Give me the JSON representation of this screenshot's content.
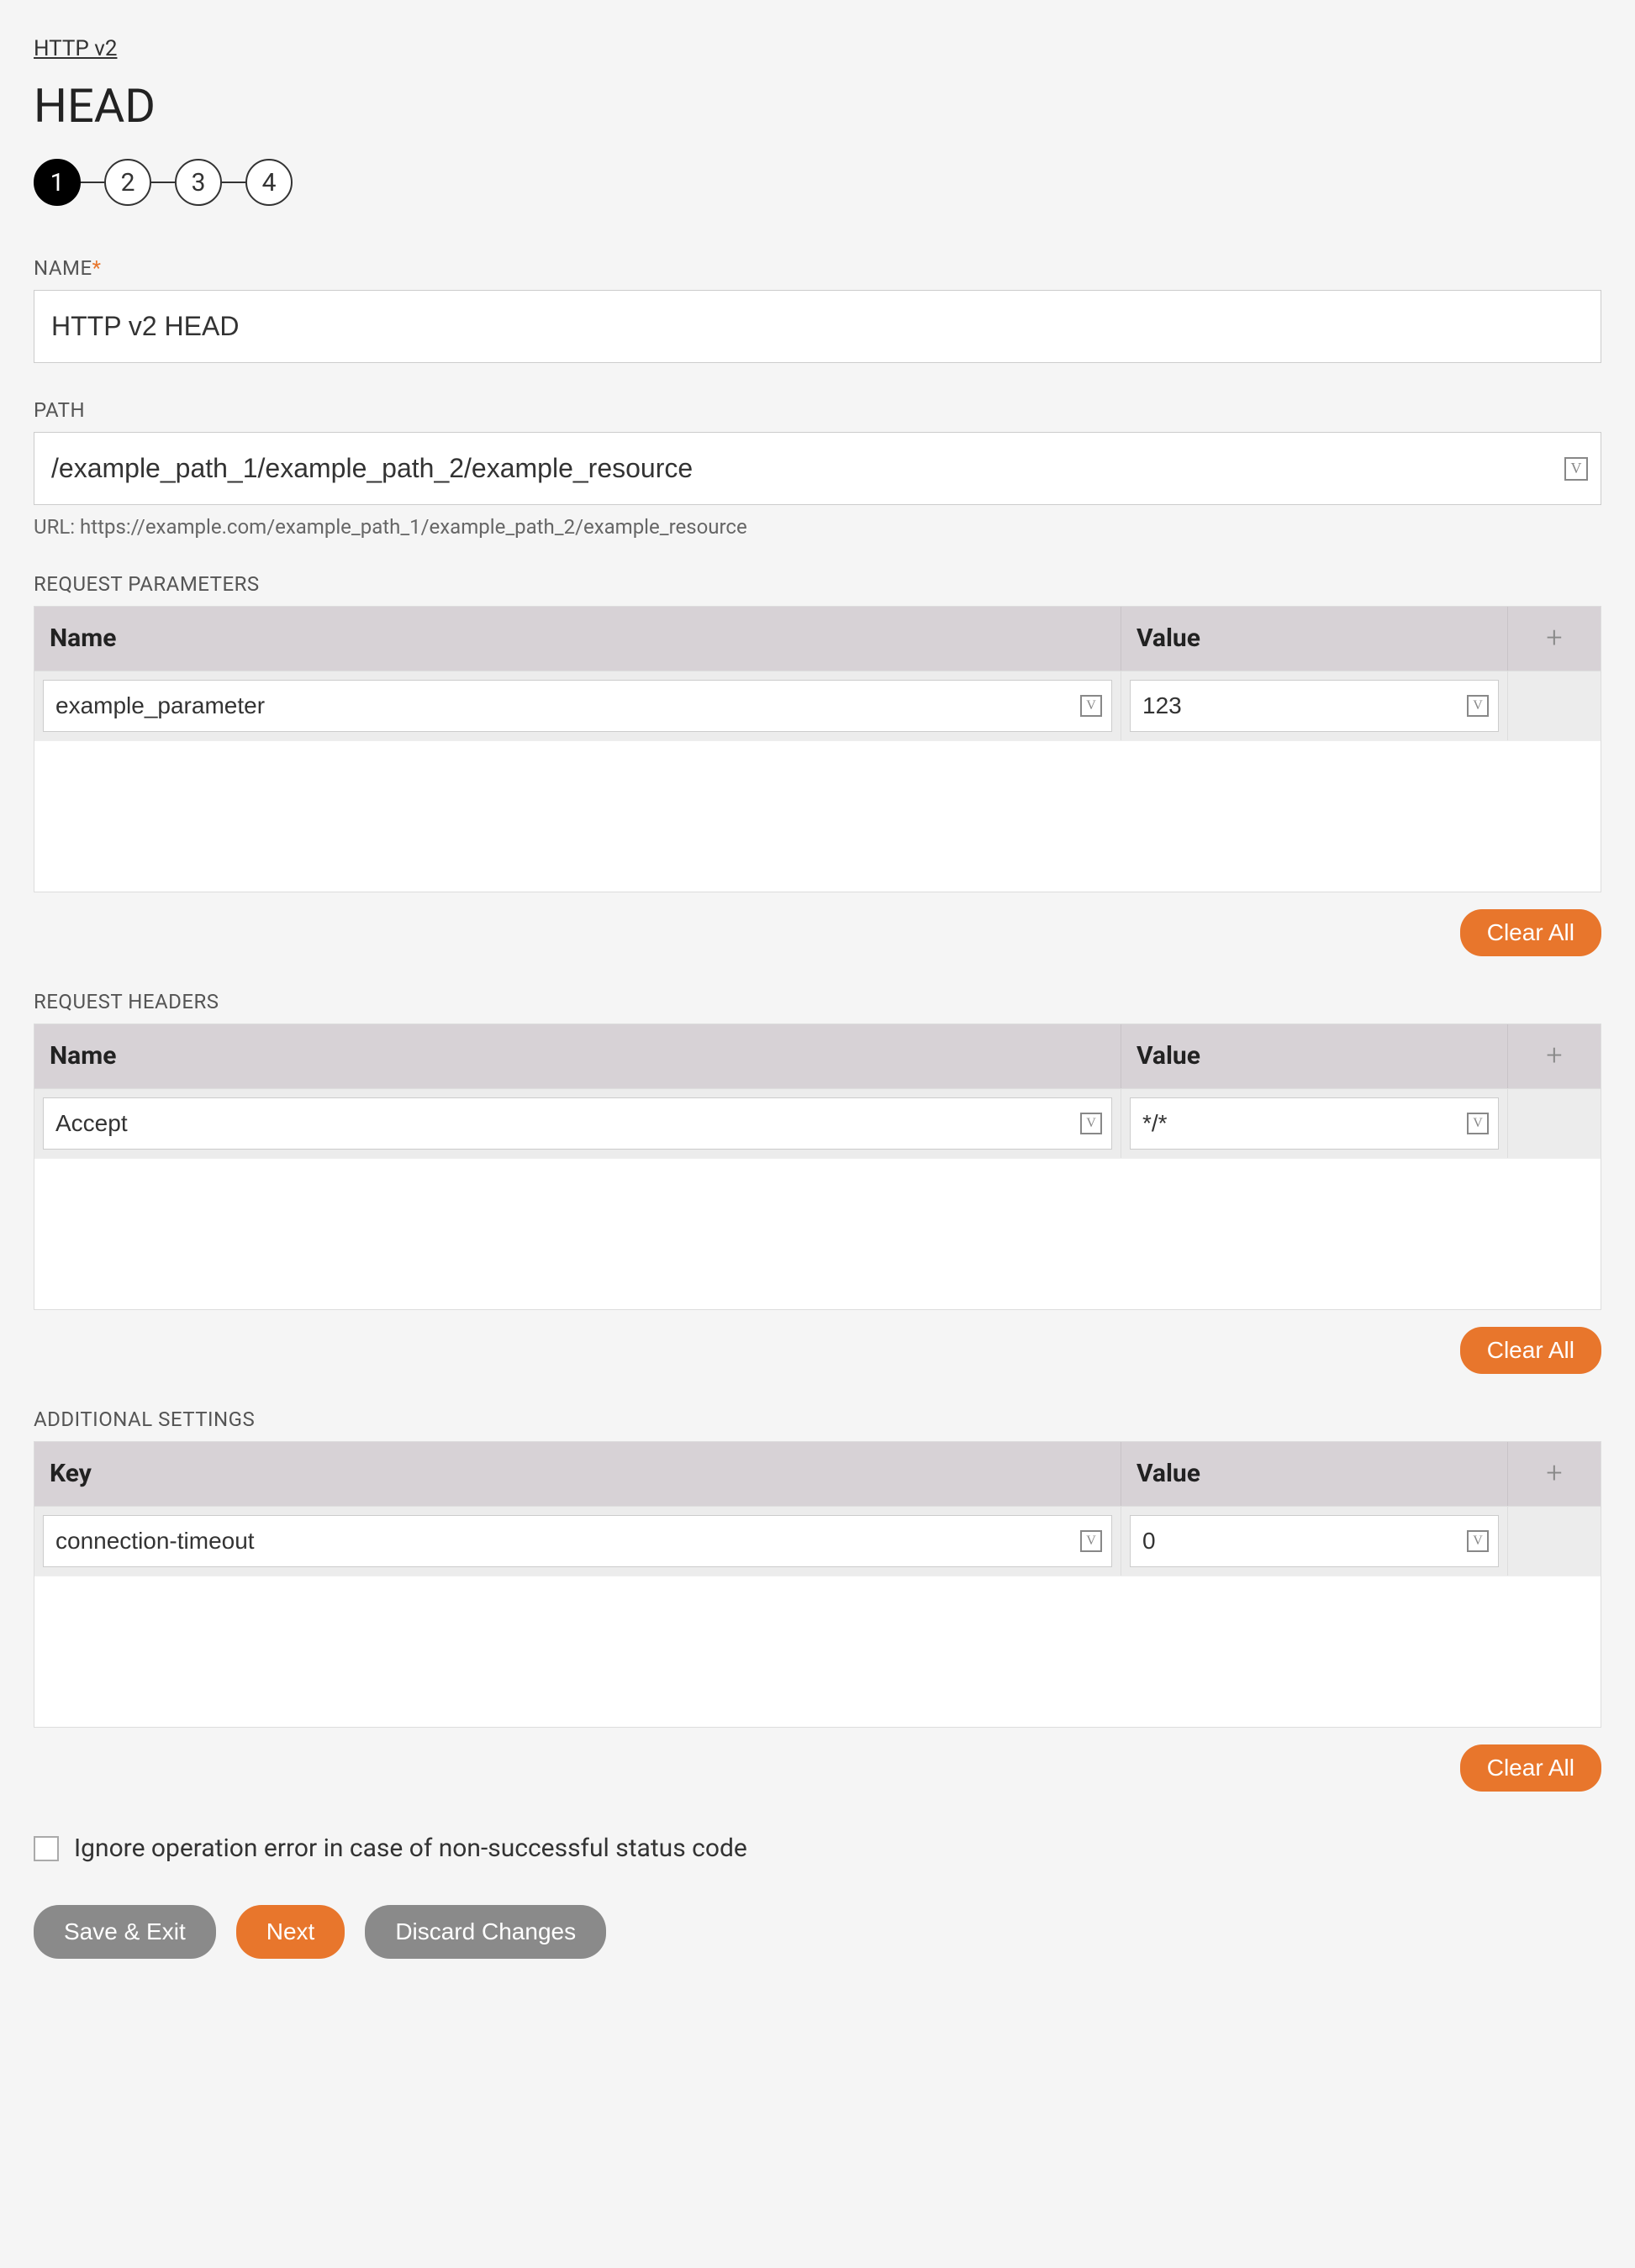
{
  "breadcrumb": "HTTP v2",
  "title": "HEAD",
  "steps": [
    "1",
    "2",
    "3",
    "4"
  ],
  "activeStep": 0,
  "nameField": {
    "label": "NAME",
    "value": "HTTP v2 HEAD"
  },
  "pathField": {
    "label": "PATH",
    "value": "/example_path_1/example_path_2/example_resource"
  },
  "urlPreview": "URL: https://example.com/example_path_1/example_path_2/example_resource",
  "variableGlyph": "V",
  "plusGlyph": "+",
  "params": {
    "label": "REQUEST PARAMETERS",
    "cols": [
      "Name",
      "Value"
    ],
    "rows": [
      {
        "name": "example_parameter",
        "value": "123"
      }
    ],
    "clear": "Clear All"
  },
  "headers": {
    "label": "REQUEST HEADERS",
    "cols": [
      "Name",
      "Value"
    ],
    "rows": [
      {
        "name": "Accept",
        "value": "*/*"
      }
    ],
    "clear": "Clear All"
  },
  "additional": {
    "label": "ADDITIONAL SETTINGS",
    "cols": [
      "Key",
      "Value"
    ],
    "rows": [
      {
        "name": "connection-timeout",
        "value": "0"
      }
    ],
    "clear": "Clear All"
  },
  "ignoreError": {
    "label": "Ignore operation error in case of non-successful status code",
    "checked": false
  },
  "buttons": {
    "saveExit": "Save & Exit",
    "next": "Next",
    "discard": "Discard Changes"
  }
}
